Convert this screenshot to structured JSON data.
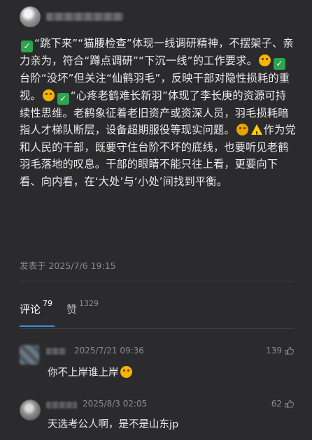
{
  "post": {
    "author_avatar": "avatar",
    "segments": [
      {
        "type": "icon",
        "name": "check-mark-icon"
      },
      {
        "type": "text",
        "value": "“跳下来”“猫腰检查”体现一线调研精神，不摆架子、亲力亲为，符合“蹲点调研”“下沉一线”的工作要求。"
      },
      {
        "type": "icon",
        "name": "thinking-face-icon"
      },
      {
        "type": "icon",
        "name": "check-mark-icon"
      },
      {
        "type": "text",
        "value": "台阶“没坏”但关注“仙鹤羽毛”，反映干部对隐性损耗的重视。"
      },
      {
        "type": "icon",
        "name": "thinking-face-icon"
      },
      {
        "type": "icon",
        "name": "check-mark-icon"
      },
      {
        "type": "text",
        "value": "“心疼老鹤难长新羽”体现了李长庚的资源可持续性思维。老鹤象征着老旧资产或资深人员，羽毛损耗暗指人才梯队断层，设备超期服役等现实问题。"
      },
      {
        "type": "icon",
        "name": "worried-face-icon"
      },
      {
        "type": "icon",
        "name": "warning-icon"
      },
      {
        "type": "text",
        "value": "作为党和人民的干部，既要守住台阶不坏的底线，也要听见老鹤羽毛落地的叹息。干部的眼睛不能只往上看，更要向下看、向内看，在‘大处’与‘小处’间找到平衡。"
      }
    ],
    "published": "发表于 2025/7/6 19:15"
  },
  "tabs": [
    {
      "label": "评论",
      "count": "79",
      "active": true
    },
    {
      "label": "赞",
      "count": "1329",
      "active": false
    }
  ],
  "comments": [
    {
      "time": "2025/7/21 09:36",
      "likes": "139",
      "text": "你不上岸谁上岸",
      "emoji": "laughing-face-icon"
    },
    {
      "time": "2025/8/3 02:05",
      "likes": "62",
      "text": "天选考公人啊，是不是山东jp",
      "emoji": ""
    }
  ],
  "colors": {
    "background": "#2b2b2d",
    "accent": "#3a8ee6",
    "check": "#2da44e",
    "emoji": "#f4b400",
    "warning": "#ffcc00"
  }
}
